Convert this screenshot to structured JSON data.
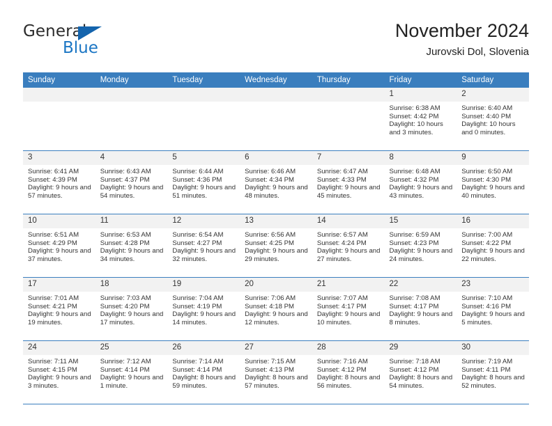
{
  "brand": {
    "name_top": "General",
    "name_bottom": "Blue",
    "accent_color": "#1b76c4"
  },
  "header": {
    "title": "November 2024",
    "subtitle": "Jurovski Dol, Slovenia"
  },
  "theme": {
    "header_blue": "#3a7ebe",
    "daynum_gray": "#f2f2f2",
    "text": "#333333"
  },
  "weekdays": [
    "Sunday",
    "Monday",
    "Tuesday",
    "Wednesday",
    "Thursday",
    "Friday",
    "Saturday"
  ],
  "labels": {
    "sunrise_prefix": "Sunrise: ",
    "sunset_prefix": "Sunset: ",
    "daylight_prefix": "Daylight: "
  },
  "weeks": [
    [
      {
        "day": "",
        "blank": true
      },
      {
        "day": "",
        "blank": true
      },
      {
        "day": "",
        "blank": true
      },
      {
        "day": "",
        "blank": true
      },
      {
        "day": "",
        "blank": true
      },
      {
        "day": "1",
        "sunrise": "Sunrise: 6:38 AM",
        "sunset": "Sunset: 4:42 PM",
        "daylight": "Daylight: 10 hours and 3 minutes."
      },
      {
        "day": "2",
        "sunrise": "Sunrise: 6:40 AM",
        "sunset": "Sunset: 4:40 PM",
        "daylight": "Daylight: 10 hours and 0 minutes."
      }
    ],
    [
      {
        "day": "3",
        "sunrise": "Sunrise: 6:41 AM",
        "sunset": "Sunset: 4:39 PM",
        "daylight": "Daylight: 9 hours and 57 minutes."
      },
      {
        "day": "4",
        "sunrise": "Sunrise: 6:43 AM",
        "sunset": "Sunset: 4:37 PM",
        "daylight": "Daylight: 9 hours and 54 minutes."
      },
      {
        "day": "5",
        "sunrise": "Sunrise: 6:44 AM",
        "sunset": "Sunset: 4:36 PM",
        "daylight": "Daylight: 9 hours and 51 minutes."
      },
      {
        "day": "6",
        "sunrise": "Sunrise: 6:46 AM",
        "sunset": "Sunset: 4:34 PM",
        "daylight": "Daylight: 9 hours and 48 minutes."
      },
      {
        "day": "7",
        "sunrise": "Sunrise: 6:47 AM",
        "sunset": "Sunset: 4:33 PM",
        "daylight": "Daylight: 9 hours and 45 minutes."
      },
      {
        "day": "8",
        "sunrise": "Sunrise: 6:48 AM",
        "sunset": "Sunset: 4:32 PM",
        "daylight": "Daylight: 9 hours and 43 minutes."
      },
      {
        "day": "9",
        "sunrise": "Sunrise: 6:50 AM",
        "sunset": "Sunset: 4:30 PM",
        "daylight": "Daylight: 9 hours and 40 minutes."
      }
    ],
    [
      {
        "day": "10",
        "sunrise": "Sunrise: 6:51 AM",
        "sunset": "Sunset: 4:29 PM",
        "daylight": "Daylight: 9 hours and 37 minutes."
      },
      {
        "day": "11",
        "sunrise": "Sunrise: 6:53 AM",
        "sunset": "Sunset: 4:28 PM",
        "daylight": "Daylight: 9 hours and 34 minutes."
      },
      {
        "day": "12",
        "sunrise": "Sunrise: 6:54 AM",
        "sunset": "Sunset: 4:27 PM",
        "daylight": "Daylight: 9 hours and 32 minutes."
      },
      {
        "day": "13",
        "sunrise": "Sunrise: 6:56 AM",
        "sunset": "Sunset: 4:25 PM",
        "daylight": "Daylight: 9 hours and 29 minutes."
      },
      {
        "day": "14",
        "sunrise": "Sunrise: 6:57 AM",
        "sunset": "Sunset: 4:24 PM",
        "daylight": "Daylight: 9 hours and 27 minutes."
      },
      {
        "day": "15",
        "sunrise": "Sunrise: 6:59 AM",
        "sunset": "Sunset: 4:23 PM",
        "daylight": "Daylight: 9 hours and 24 minutes."
      },
      {
        "day": "16",
        "sunrise": "Sunrise: 7:00 AM",
        "sunset": "Sunset: 4:22 PM",
        "daylight": "Daylight: 9 hours and 22 minutes."
      }
    ],
    [
      {
        "day": "17",
        "sunrise": "Sunrise: 7:01 AM",
        "sunset": "Sunset: 4:21 PM",
        "daylight": "Daylight: 9 hours and 19 minutes."
      },
      {
        "day": "18",
        "sunrise": "Sunrise: 7:03 AM",
        "sunset": "Sunset: 4:20 PM",
        "daylight": "Daylight: 9 hours and 17 minutes."
      },
      {
        "day": "19",
        "sunrise": "Sunrise: 7:04 AM",
        "sunset": "Sunset: 4:19 PM",
        "daylight": "Daylight: 9 hours and 14 minutes."
      },
      {
        "day": "20",
        "sunrise": "Sunrise: 7:06 AM",
        "sunset": "Sunset: 4:18 PM",
        "daylight": "Daylight: 9 hours and 12 minutes."
      },
      {
        "day": "21",
        "sunrise": "Sunrise: 7:07 AM",
        "sunset": "Sunset: 4:17 PM",
        "daylight": "Daylight: 9 hours and 10 minutes."
      },
      {
        "day": "22",
        "sunrise": "Sunrise: 7:08 AM",
        "sunset": "Sunset: 4:17 PM",
        "daylight": "Daylight: 9 hours and 8 minutes."
      },
      {
        "day": "23",
        "sunrise": "Sunrise: 7:10 AM",
        "sunset": "Sunset: 4:16 PM",
        "daylight": "Daylight: 9 hours and 5 minutes."
      }
    ],
    [
      {
        "day": "24",
        "sunrise": "Sunrise: 7:11 AM",
        "sunset": "Sunset: 4:15 PM",
        "daylight": "Daylight: 9 hours and 3 minutes."
      },
      {
        "day": "25",
        "sunrise": "Sunrise: 7:12 AM",
        "sunset": "Sunset: 4:14 PM",
        "daylight": "Daylight: 9 hours and 1 minute."
      },
      {
        "day": "26",
        "sunrise": "Sunrise: 7:14 AM",
        "sunset": "Sunset: 4:14 PM",
        "daylight": "Daylight: 8 hours and 59 minutes."
      },
      {
        "day": "27",
        "sunrise": "Sunrise: 7:15 AM",
        "sunset": "Sunset: 4:13 PM",
        "daylight": "Daylight: 8 hours and 57 minutes."
      },
      {
        "day": "28",
        "sunrise": "Sunrise: 7:16 AM",
        "sunset": "Sunset: 4:12 PM",
        "daylight": "Daylight: 8 hours and 56 minutes."
      },
      {
        "day": "29",
        "sunrise": "Sunrise: 7:18 AM",
        "sunset": "Sunset: 4:12 PM",
        "daylight": "Daylight: 8 hours and 54 minutes."
      },
      {
        "day": "30",
        "sunrise": "Sunrise: 7:19 AM",
        "sunset": "Sunset: 4:11 PM",
        "daylight": "Daylight: 8 hours and 52 minutes."
      }
    ]
  ]
}
